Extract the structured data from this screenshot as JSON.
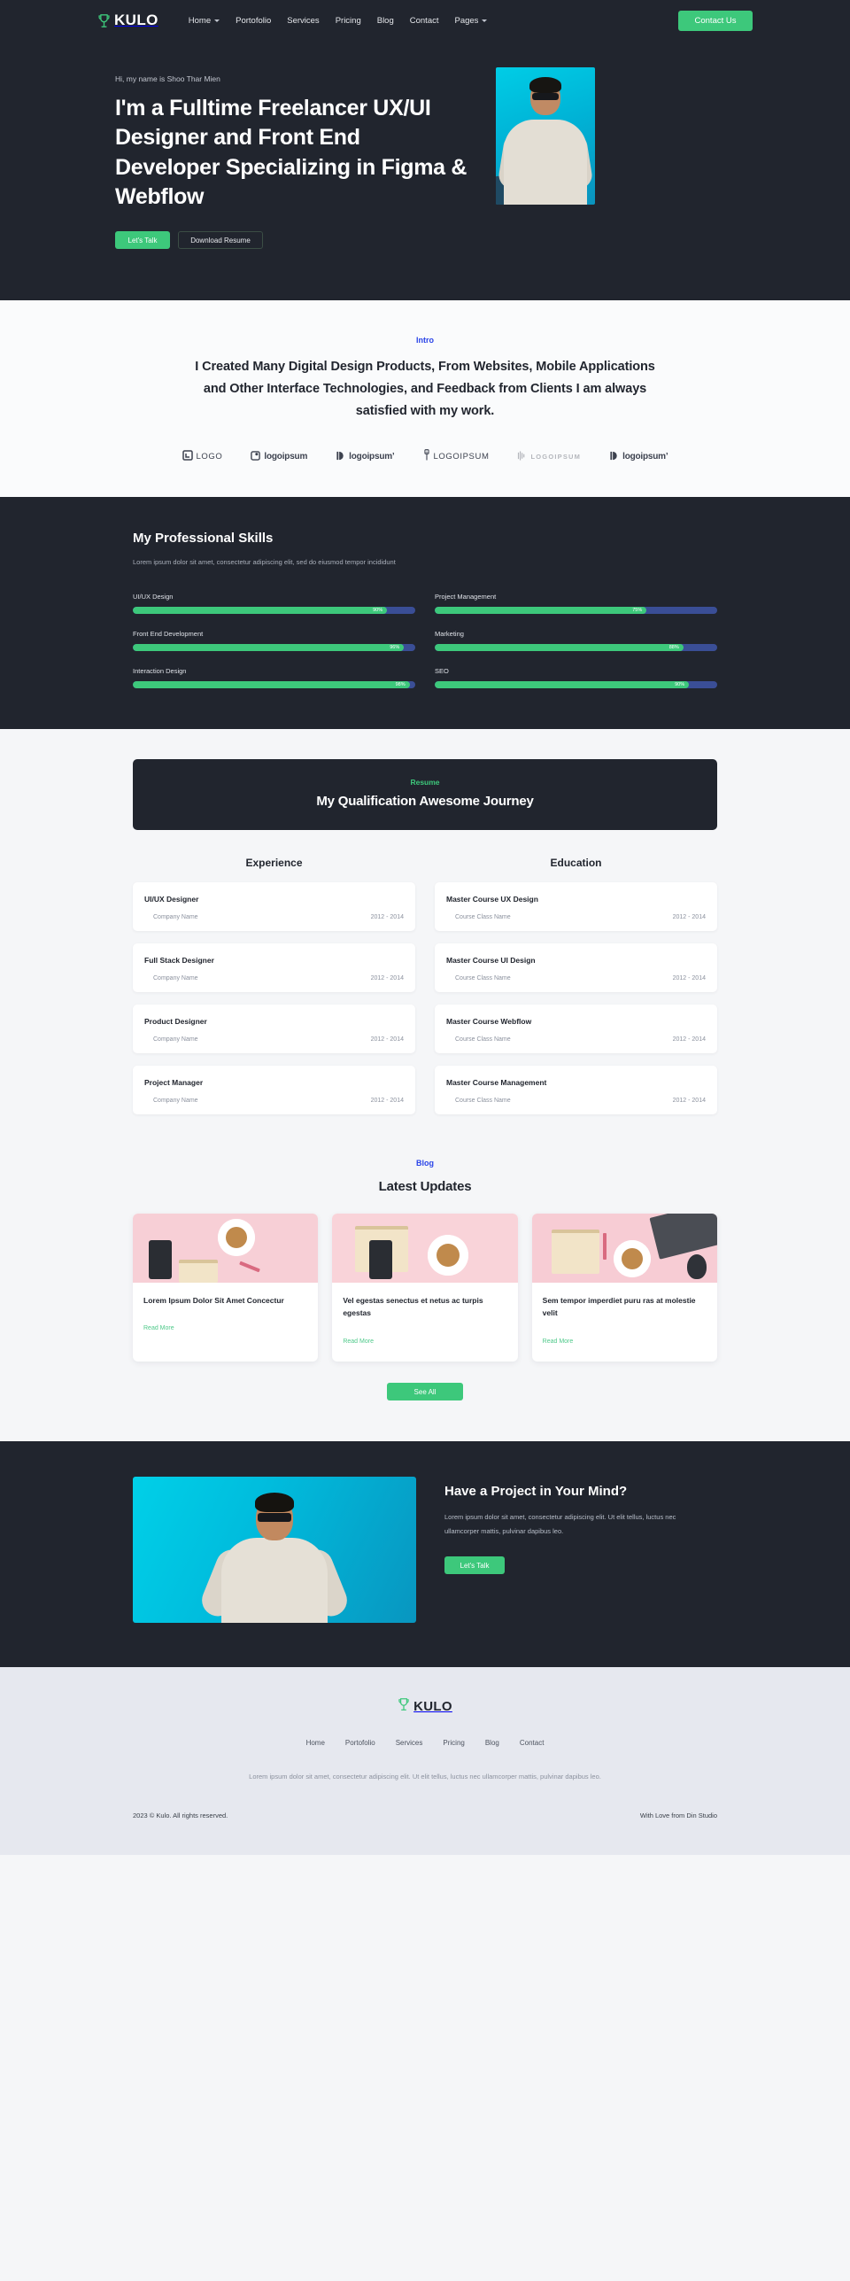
{
  "navbar": {
    "brand": {
      "name": "KULO",
      "icon": "trophy-icon"
    },
    "links": [
      {
        "label": "Home",
        "has_dropdown": true
      },
      {
        "label": "Portofolio",
        "has_dropdown": false
      },
      {
        "label": "Services",
        "has_dropdown": false
      },
      {
        "label": "Pricing",
        "has_dropdown": false
      },
      {
        "label": "Blog",
        "has_dropdown": false
      },
      {
        "label": "Contact",
        "has_dropdown": false
      },
      {
        "label": "Pages",
        "has_dropdown": true
      }
    ],
    "cta_label": "Contact Us"
  },
  "hero": {
    "eyebrow": "Hi, my name is Shoo Thar Mien",
    "title": "I'm a Fulltime Freelancer UX/UI Designer and Front End Developer Specializing in Figma & Webflow",
    "primary_button": "Let's Talk",
    "secondary_button": "Download Resume"
  },
  "intro": {
    "eyebrow": "Intro",
    "headline": "I Created Many Digital Design Products, From Websites, Mobile Applications and Other Interface Technologies, and Feedback from Clients I am always satisfied with my work.",
    "logos": [
      {
        "text": "LOGO",
        "style": "blocky"
      },
      {
        "text": "logoipsum",
        "style": "bold"
      },
      {
        "text": "logoipsum’",
        "style": "bold"
      },
      {
        "text": "LOGOIPSUM",
        "style": "wide"
      },
      {
        "text": "LOGOIPSUM",
        "style": "spread"
      },
      {
        "text": "logoipsum’",
        "style": "bold"
      }
    ]
  },
  "skills": {
    "title": "My Professional Skills",
    "subtitle": "Lorem ipsum dolor sit amet, consectetur adipiscing elit, sed do eiusmod tempor incididunt",
    "items": [
      {
        "label": "UI/UX Design",
        "percent": "90%",
        "value": 90
      },
      {
        "label": "Project Management",
        "percent": "75%",
        "value": 75
      },
      {
        "label": "Front End Development",
        "percent": "96%",
        "value": 96
      },
      {
        "label": "Marketing",
        "percent": "88%",
        "value": 88
      },
      {
        "label": "Interaction Design",
        "percent": "98%",
        "value": 98
      },
      {
        "label": "SEO",
        "percent": "90%",
        "value": 90
      }
    ]
  },
  "resume": {
    "eyebrow": "Resume",
    "banner_title": "My Qualification Awesome Journey",
    "experience_heading": "Experience",
    "education_heading": "Education",
    "experience": [
      {
        "title": "UI/UX Designer",
        "sub": "Company Name",
        "years": "2012 - 2014"
      },
      {
        "title": "Full Stack Designer",
        "sub": "Company Name",
        "years": "2012 - 2014"
      },
      {
        "title": "Product Designer",
        "sub": "Company Name",
        "years": "2012 - 2014"
      },
      {
        "title": "Project Manager",
        "sub": "Company Name",
        "years": "2012 - 2014"
      }
    ],
    "education": [
      {
        "title": "Master Course UX Design",
        "sub": "Course Class Name",
        "years": "2012 - 2014"
      },
      {
        "title": "Master Course UI Design",
        "sub": "Course Class Name",
        "years": "2012 - 2014"
      },
      {
        "title": "Master Course Webflow",
        "sub": "Course Class Name",
        "years": "2012 - 2014"
      },
      {
        "title": "Master Course Management",
        "sub": "Course Class Name",
        "years": "2012 - 2014"
      }
    ]
  },
  "blog": {
    "eyebrow": "Blog",
    "title": "Latest Updates",
    "posts": [
      {
        "title": "Lorem Ipsum Dolor Sit Amet Concectur",
        "link": "Read More"
      },
      {
        "title": "Vel egestas senectus et netus ac turpis egestas",
        "link": "Read More"
      },
      {
        "title": "Sem tempor imperdiet puru ras at molestie velit",
        "link": "Read More"
      }
    ],
    "see_all_label": "See All"
  },
  "cta": {
    "title": "Have a Project in Your Mind?",
    "text": "Lorem ipsum dolor sit amet, consectetur adipiscing elit. Ut elit tellus, luctus nec ullamcorper mattis, pulvinar dapibus leo.",
    "button": "Let's Talk"
  },
  "footer": {
    "brand": {
      "name": "KULO",
      "icon": "trophy-icon"
    },
    "links": [
      "Home",
      "Portofolio",
      "Services",
      "Pricing",
      "Blog",
      "Contact"
    ],
    "text": "Lorem ipsum dolor sit amet, consectetur adipiscing elit. Ut elit tellus, luctus nec ullamcorper mattis, pulvinar dapibus leo.",
    "copyright": "2023 © Kulo. All rights reserved.",
    "credit": "With Love from Din Studio"
  },
  "colors": {
    "dark": "#21252e",
    "accent_green": "#3dc87b",
    "accent_blue": "#2a44e8",
    "track_blue": "#3a4e96",
    "page_bg": "#f5f6f8",
    "footer_bg": "#e6e8ef"
  }
}
